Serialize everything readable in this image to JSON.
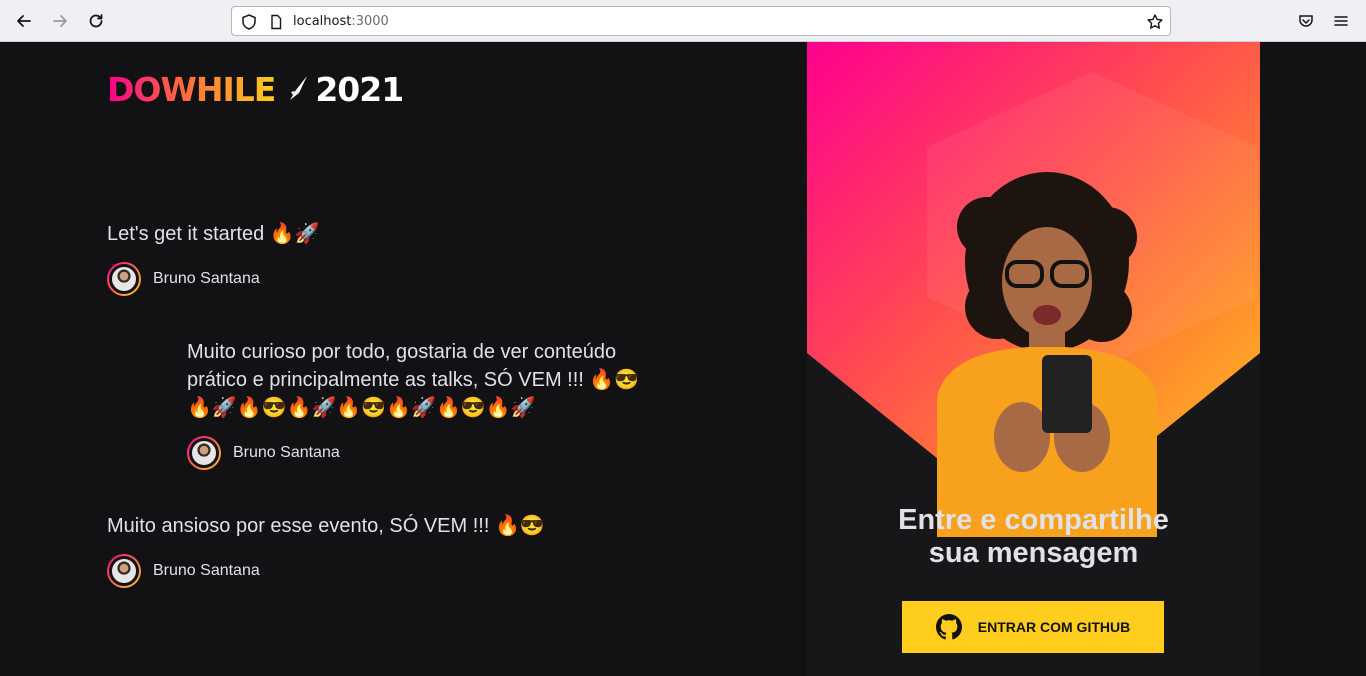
{
  "browser": {
    "url_host": "localhost",
    "url_port": ":3000"
  },
  "logo": {
    "brand": "DOWHILE",
    "year": "2021"
  },
  "messages": [
    {
      "text": "Let's get it started 🔥🚀",
      "user": "Bruno Santana"
    },
    {
      "text": "Muito curioso por todo, gostaria de ver conteúdo prático e principalmente as talks, SÓ VEM !!! 🔥😎🔥🚀🔥😎🔥🚀🔥😎🔥🚀🔥😎🔥🚀",
      "user": "Bruno Santana"
    },
    {
      "text": "Muito ansioso por esse evento, SÓ VEM !!! 🔥😎",
      "user": "Bruno Santana"
    }
  ],
  "sign_in": {
    "title_line1": "Entre e compartilhe",
    "title_line2": "sua mensagem",
    "button_label": "ENTRAR COM GITHUB"
  },
  "colors": {
    "background": "#121214",
    "accent_pink": "#ff008e",
    "accent_yellow": "#ffcd1e",
    "text": "#e1e1e6"
  },
  "icons": [
    "back-arrow-icon",
    "forward-arrow-icon",
    "reload-icon",
    "shield-icon",
    "page-icon",
    "star-icon",
    "pocket-icon",
    "menu-icon",
    "rocket-icon",
    "github-icon"
  ]
}
